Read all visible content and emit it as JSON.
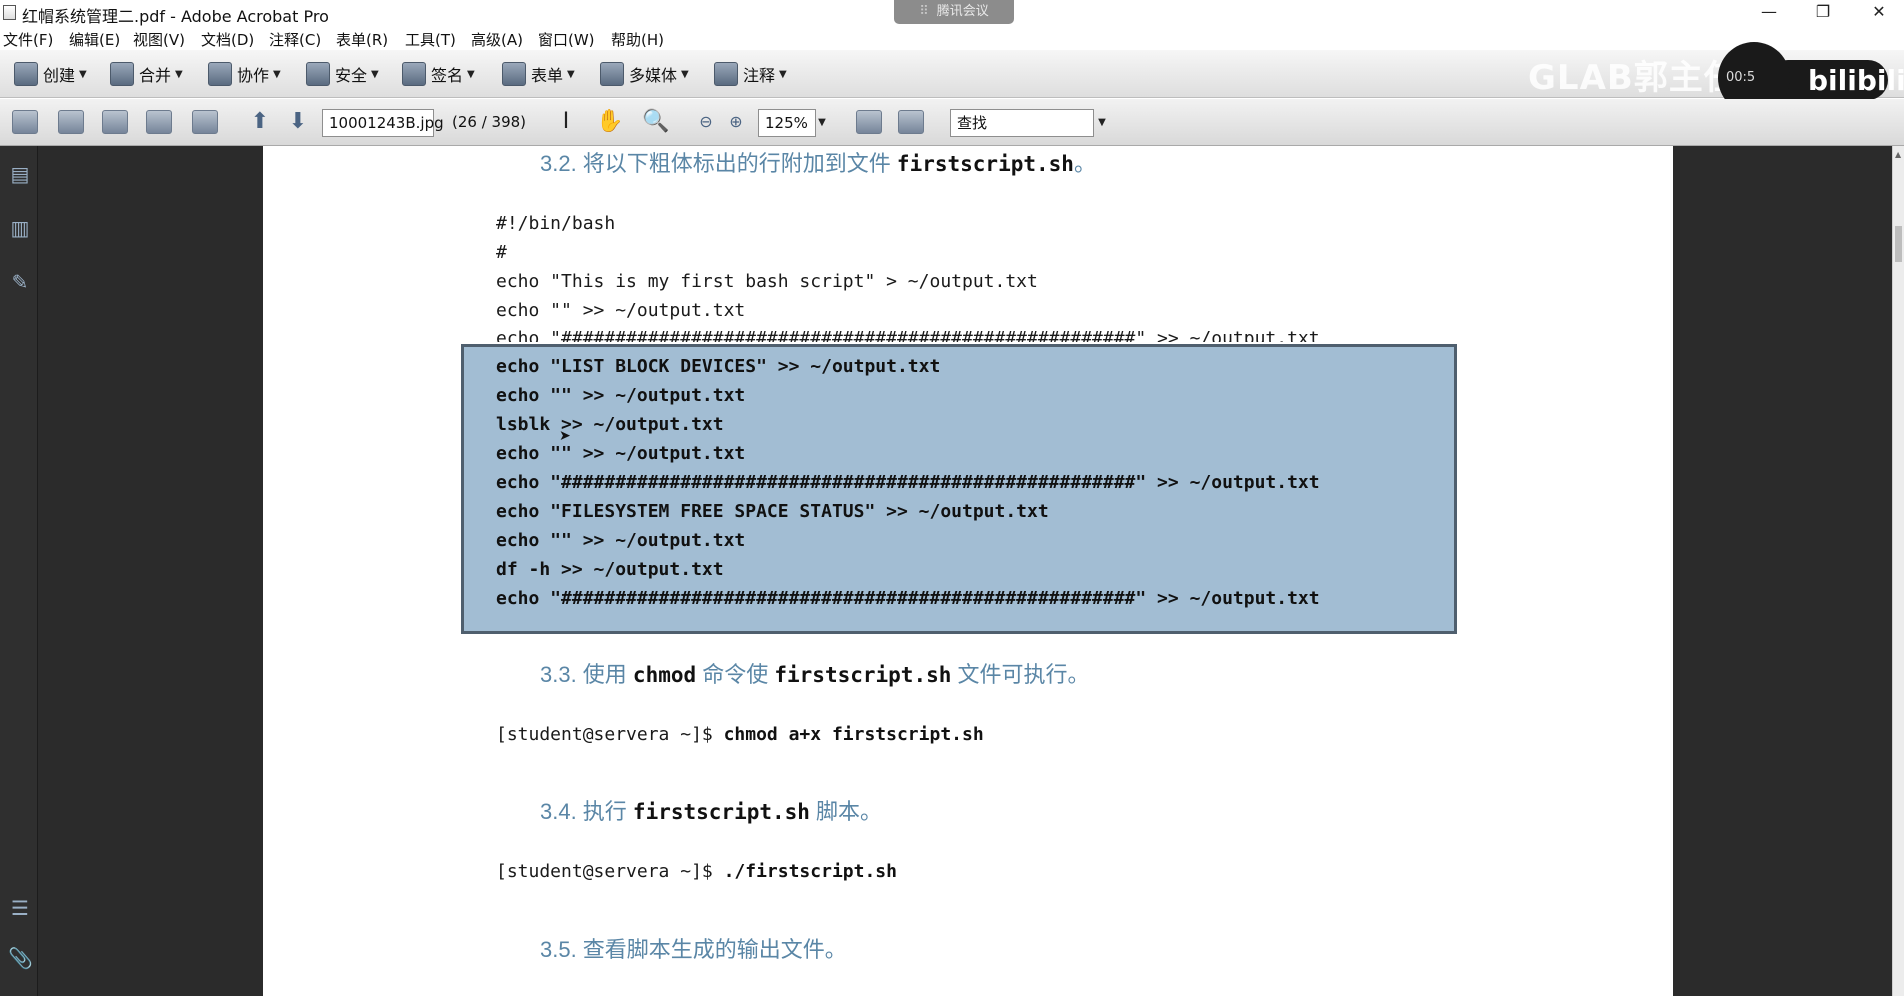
{
  "window": {
    "title": "红帽系统管理二.pdf - Adobe Acrobat Pro",
    "meeting_label": "腾讯会议",
    "minimize": "—",
    "restore": "❐",
    "close": "✕"
  },
  "menu": [
    "文件(F)",
    "编辑(E)",
    "视图(V)",
    "文档(D)",
    "注释(C)",
    "表单(R)",
    "工具(T)",
    "高级(A)",
    "窗口(W)",
    "帮助(H)"
  ],
  "tasks": [
    "创建",
    "合并",
    "协作",
    "安全",
    "签名",
    "表单",
    "多媒体",
    "注释"
  ],
  "overlay": {
    "watermark": "GLAB郭主任",
    "video_time": "00:5",
    "logo": "bilibili"
  },
  "navbar": {
    "filename": "10001243B.jpg",
    "page_count": "(26 / 398)",
    "zoom": "125%",
    "search_placeholder": "查找"
  },
  "document": {
    "heading_3_2": {
      "prefix": "3.2. 将以下粗体标出的行附加到文件 ",
      "file": "firstscript.sh",
      "suffix": "。"
    },
    "script_lines": [
      "#!/bin/bash",
      "#",
      "echo \"This is my first bash script\" > ~/output.txt",
      "echo \"\" >> ~/output.txt",
      "echo \"#####################################################\" >> ~/output.txt"
    ],
    "bold_lines": [
      "echo \"LIST BLOCK DEVICES\" >> ~/output.txt",
      "echo \"\" >> ~/output.txt",
      "lsblk >> ~/output.txt",
      "echo \"\" >> ~/output.txt",
      "echo \"#####################################################\" >> ~/output.txt",
      "echo \"FILESYSTEM FREE SPACE STATUS\" >> ~/output.txt",
      "echo \"\" >> ~/output.txt",
      "df -h >> ~/output.txt",
      "echo \"#####################################################\" >> ~/output.txt"
    ],
    "heading_3_3": {
      "prefix": "3.3. 使用 ",
      "cmd": "chmod",
      "mid": " 命令使 ",
      "file": "firstscript.sh",
      "suffix": " 文件可执行。"
    },
    "cmd_3_3": {
      "prompt": "[student@servera ~]$ ",
      "command": "chmod a+x firstscript.sh"
    },
    "heading_3_4": {
      "prefix": "3.4. 执行 ",
      "file": "firstscript.sh",
      "suffix": " 脚本。"
    },
    "cmd_3_4": {
      "prompt": "[student@servera ~]$ ",
      "command": "./firstscript.sh"
    },
    "heading_3_5": {
      "text": "3.5. 查看脚本生成的输出文件。"
    }
  }
}
